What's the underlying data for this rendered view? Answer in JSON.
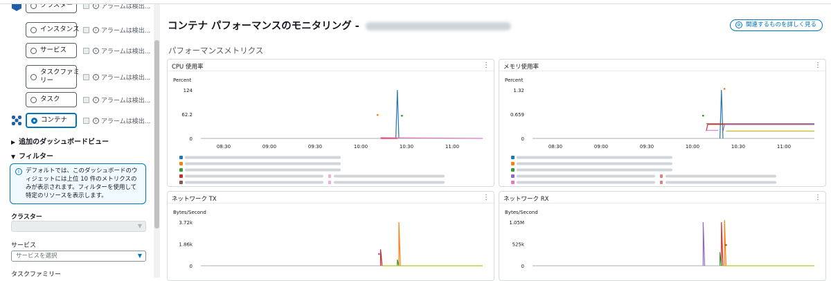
{
  "sidebar": {
    "nodes": [
      {
        "label": "クラスター",
        "alarm": "アラームは検出...",
        "selected": false
      },
      {
        "label": "インスタンス",
        "alarm": "アラームは検出...",
        "selected": false
      },
      {
        "label": "サービス",
        "alarm": "アラームは検出...",
        "selected": false
      },
      {
        "label": "タスクファミ",
        "label2": "リー",
        "alarm": "アラームは検出...",
        "selected": false
      },
      {
        "label": "タスク",
        "alarm": "アラームは検出...",
        "selected": false
      },
      {
        "label": "コンテナ",
        "alarm": "アラームは検出...",
        "selected": true
      }
    ],
    "additional_dashboards": "追加のダッシュボードビュー",
    "filters_title": "フィルター",
    "info_text": "デフォルトでは、このダッシュボードのウィジェットには上位 10 件のメトリクスのみが表示されます。フィルターを使用して特定のリソースを表示します。",
    "cluster_label": "クラスター",
    "service_label": "サービス",
    "service_placeholder": "サービスを選択",
    "taskfamily_label": "タスクファミリー"
  },
  "main": {
    "title": "コンテナ パフォーマンスのモニタリング - ",
    "more_button": "関連するものを詳しく見る",
    "section": "パフォーマンスメトリクス"
  },
  "colors": {
    "blue": "#1f77b4",
    "orange": "#ff7f0e",
    "green": "#2ca02c",
    "red": "#d62728",
    "purple": "#9467bd",
    "brown": "#8c564b",
    "pink": "#e377c2",
    "olive": "#bcbd22",
    "accent": "#0073bb"
  },
  "chart_data": [
    {
      "type": "line",
      "title": "CPU 使用率",
      "ylabel": "Percent",
      "ylim": [
        0,
        124
      ],
      "yticks": [
        "124",
        "62.2",
        "0"
      ],
      "x": [
        "08:30",
        "09:00",
        "09:30",
        "10:00",
        "10:30",
        "11:00"
      ],
      "xrange": [
        "08:15",
        "11:20"
      ],
      "series": [
        {
          "color": "blue",
          "points": [
            [
              "10:23",
              0
            ],
            [
              "10:24",
              124
            ],
            [
              "10:25",
              0
            ]
          ]
        },
        {
          "color": "orange",
          "points": [
            [
              "10:11",
              60
            ]
          ]
        },
        {
          "color": "green",
          "points": [
            [
              "10:27",
              58
            ]
          ]
        },
        {
          "color": "red",
          "points": [
            [
              "10:13",
              0
            ],
            [
              "10:24",
              0
            ]
          ]
        },
        {
          "color": "pink",
          "points": [
            [
              "10:13",
              2
            ],
            [
              "11:20",
              0
            ]
          ]
        }
      ]
    },
    {
      "type": "line",
      "title": "メモリ使用率",
      "ylabel": "Percent",
      "ylim": [
        0,
        1.32
      ],
      "yticks": [
        "1.32",
        "0.659",
        "0"
      ],
      "x": [
        "08:30",
        "09:00",
        "09:30",
        "10:00",
        "10:30",
        "11:00"
      ],
      "xrange": [
        "08:15",
        "11:20"
      ],
      "series": [
        {
          "color": "blue",
          "points": [
            [
              "10:18",
              0
            ],
            [
              "10:19",
              1.32
            ],
            [
              "10:20",
              0
            ]
          ]
        },
        {
          "color": "orange",
          "points": [
            [
              "10:21",
              1.35
            ]
          ]
        },
        {
          "color": "green",
          "points": [
            [
              "10:07",
              0.62
            ]
          ]
        },
        {
          "color": "brown",
          "points": [
            [
              "10:09",
              0.4
            ],
            [
              "11:20",
              0.4
            ]
          ]
        },
        {
          "color": "red",
          "points": [
            [
              "10:09",
              0.2
            ],
            [
              "10:10",
              0.38
            ],
            [
              "11:20",
              0.38
            ]
          ]
        },
        {
          "color": "purple",
          "points": [
            [
              "10:20",
              0.2
            ],
            [
              "10:21",
              0.38
            ],
            [
              "11:20",
              0.38
            ]
          ]
        },
        {
          "color": "olive",
          "points": [
            [
              "10:22",
              0.2
            ],
            [
              "11:20",
              0.2
            ]
          ]
        },
        {
          "color": "pink",
          "points": [
            [
              "10:09",
              0.22
            ],
            [
              "10:17",
              0.22
            ]
          ]
        }
      ]
    },
    {
      "type": "line",
      "title": "ネットワーク TX",
      "ylabel": "Bytes/Second",
      "ylim": [
        0,
        3720
      ],
      "yticks": [
        "3.72k",
        "1.86k",
        "0"
      ],
      "x": [
        "08:30",
        "09:00",
        "09:30",
        "10:00",
        "10:30",
        "11:00"
      ],
      "xrange": [
        "08:15",
        "11:20"
      ],
      "series": [
        {
          "color": "red",
          "points": [
            [
              "10:13",
              0
            ],
            [
              "10:13",
              1400
            ],
            [
              "10:14",
              0
            ]
          ]
        },
        {
          "color": "orange",
          "points": [
            [
              "10:25",
              0
            ],
            [
              "10:25",
              3720
            ],
            [
              "10:26",
              0
            ]
          ]
        },
        {
          "color": "green",
          "points": [
            [
              "10:24",
              0
            ],
            [
              "10:24",
              520
            ],
            [
              "10:25",
              0
            ]
          ]
        },
        {
          "color": "purple",
          "points": [
            [
              "10:12",
              1000
            ]
          ]
        },
        {
          "color": "olive",
          "points": [
            [
              "10:14",
              0
            ],
            [
              "11:20",
              0
            ]
          ]
        }
      ]
    },
    {
      "type": "line",
      "title": "ネットワーク RX",
      "ylabel": "Bytes/Second",
      "ylim": [
        0,
        1050000
      ],
      "yticks": [
        "1.05M",
        "525k",
        "0"
      ],
      "x": [
        "08:30",
        "09:00",
        "09:30",
        "10:00",
        "10:30",
        "11:00"
      ],
      "xrange": [
        "08:15",
        "11:20"
      ],
      "series": [
        {
          "color": "purple",
          "points": [
            [
              "10:07",
              0
            ],
            [
              "10:07",
              1050000
            ],
            [
              "10:08",
              0
            ]
          ]
        },
        {
          "color": "red",
          "points": [
            [
              "10:19",
              0
            ],
            [
              "10:19",
              1050000
            ],
            [
              "10:20",
              0
            ]
          ]
        },
        {
          "color": "orange",
          "points": [
            [
              "10:21",
              0
            ],
            [
              "10:21",
              1100000
            ],
            [
              "10:22",
              0
            ]
          ]
        },
        {
          "color": "green",
          "points": [
            [
              "10:18",
              0
            ],
            [
              "10:18",
              330000
            ],
            [
              "10:19",
              0
            ]
          ]
        },
        {
          "color": "olive",
          "points": [
            [
              "10:20",
              0
            ],
            [
              "11:20",
              0
            ]
          ]
        },
        {
          "color": "brown",
          "points": [
            [
              "10:22",
              500000
            ]
          ]
        }
      ]
    }
  ]
}
